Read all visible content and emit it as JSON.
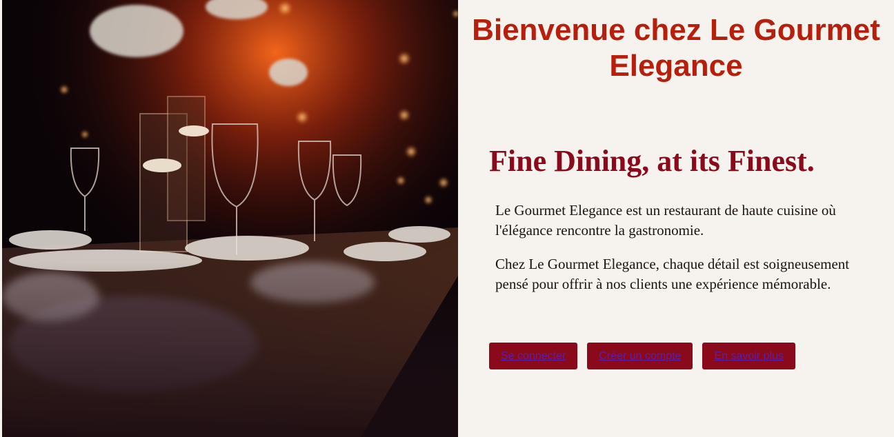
{
  "header": {
    "title": "Bienvenue chez Le Gourmet Elegance"
  },
  "hero": {
    "image_subject": "candlelit-dining-table-photo"
  },
  "main": {
    "tagline": "Fine Dining, at its Finest.",
    "paragraphs": [
      "Le Gourmet Elegance est un restaurant de haute cuisine où l'élégance rencontre la gastronomie.",
      "Chez Le Gourmet Elegance, chaque détail est soigneusement pensé pour offrir à nos clients une expérience mémorable."
    ]
  },
  "actions": {
    "login_label": "Se connecter",
    "signup_label": "Créer un compte",
    "learn_more_label": "En savoir plus"
  },
  "colors": {
    "title": "#b51f0c",
    "tagline": "#8a0a1b",
    "button_bg": "#8a0a1b",
    "button_text": "#5a1fa8",
    "page_bg": "#f6f2ee"
  }
}
